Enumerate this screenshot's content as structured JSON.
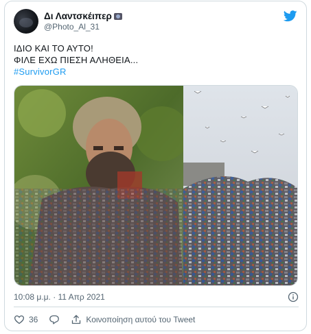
{
  "tweet": {
    "display_name": "Δι Λαντσκέιπερ",
    "handle": "@Photo_Al_31",
    "text_lines": [
      "ΙΔΙΟ ΚΑΙ ΤΟ ΑΥΤΟ!",
      "ΦΙΛΕ ΕΧΩ ΠΙΕΣΗ ΑΛΗΘΕΙΑ..."
    ],
    "hashtag": "#SurvivorGR",
    "timestamp": "10:08 μ.μ. · 11 Απρ 2021",
    "like_count": "36",
    "share_label": "Κοινοποίηση αυτού του Tweet"
  },
  "icons": {
    "brand": "twitter-bird-icon",
    "info": "info-icon",
    "like": "heart-icon",
    "reply": "reply-icon",
    "share": "share-icon"
  },
  "colors": {
    "brand_blue": "#1d9bf0",
    "text_primary": "#0f1419",
    "text_secondary": "#536471",
    "border": "#cfd9de"
  }
}
